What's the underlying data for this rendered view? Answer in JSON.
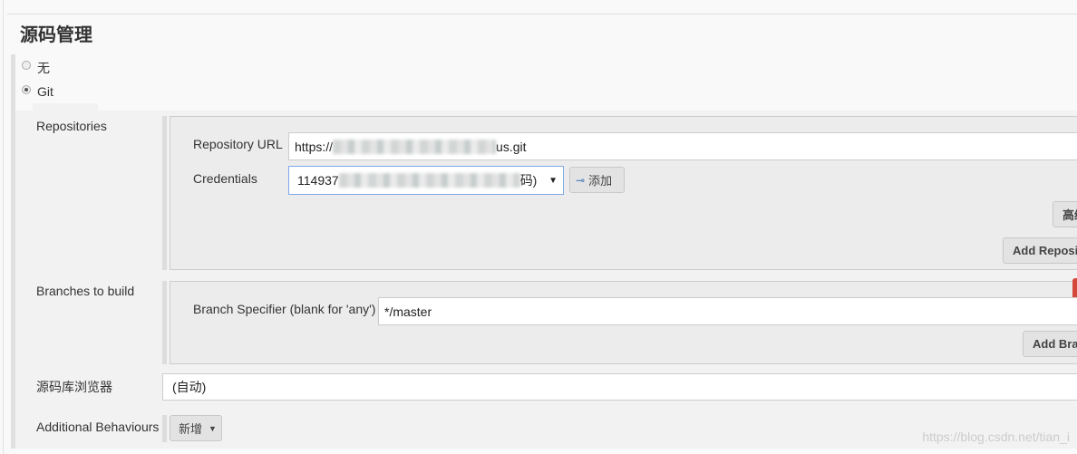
{
  "section_title": "源码管理",
  "scm_options": [
    {
      "label": "无",
      "selected": false
    },
    {
      "label": "Git",
      "selected": true
    }
  ],
  "repositories": {
    "label": "Repositories",
    "url_label": "Repository URL",
    "url_prefix": "https://",
    "url_suffix": "us.git",
    "credentials_label": "Credentials",
    "credentials_prefix": "114937",
    "credentials_suffix": "码)",
    "add_label": "添加",
    "advanced_label": "高级",
    "add_repository_label": "Add Repository"
  },
  "branches": {
    "label": "Branches to build",
    "specifier_label": "Branch Specifier (blank for 'any')",
    "specifier_value": "*/master",
    "add_branch_label": "Add Branch"
  },
  "browser": {
    "label": "源码库浏览器",
    "value": "(自动)"
  },
  "behaviours": {
    "label": "Additional Behaviours",
    "add_label": "新增"
  },
  "watermark": "https://blog.csdn.net/tian_i",
  "colors": {
    "delete": "#d24939",
    "focus": "#7fa8e8"
  }
}
